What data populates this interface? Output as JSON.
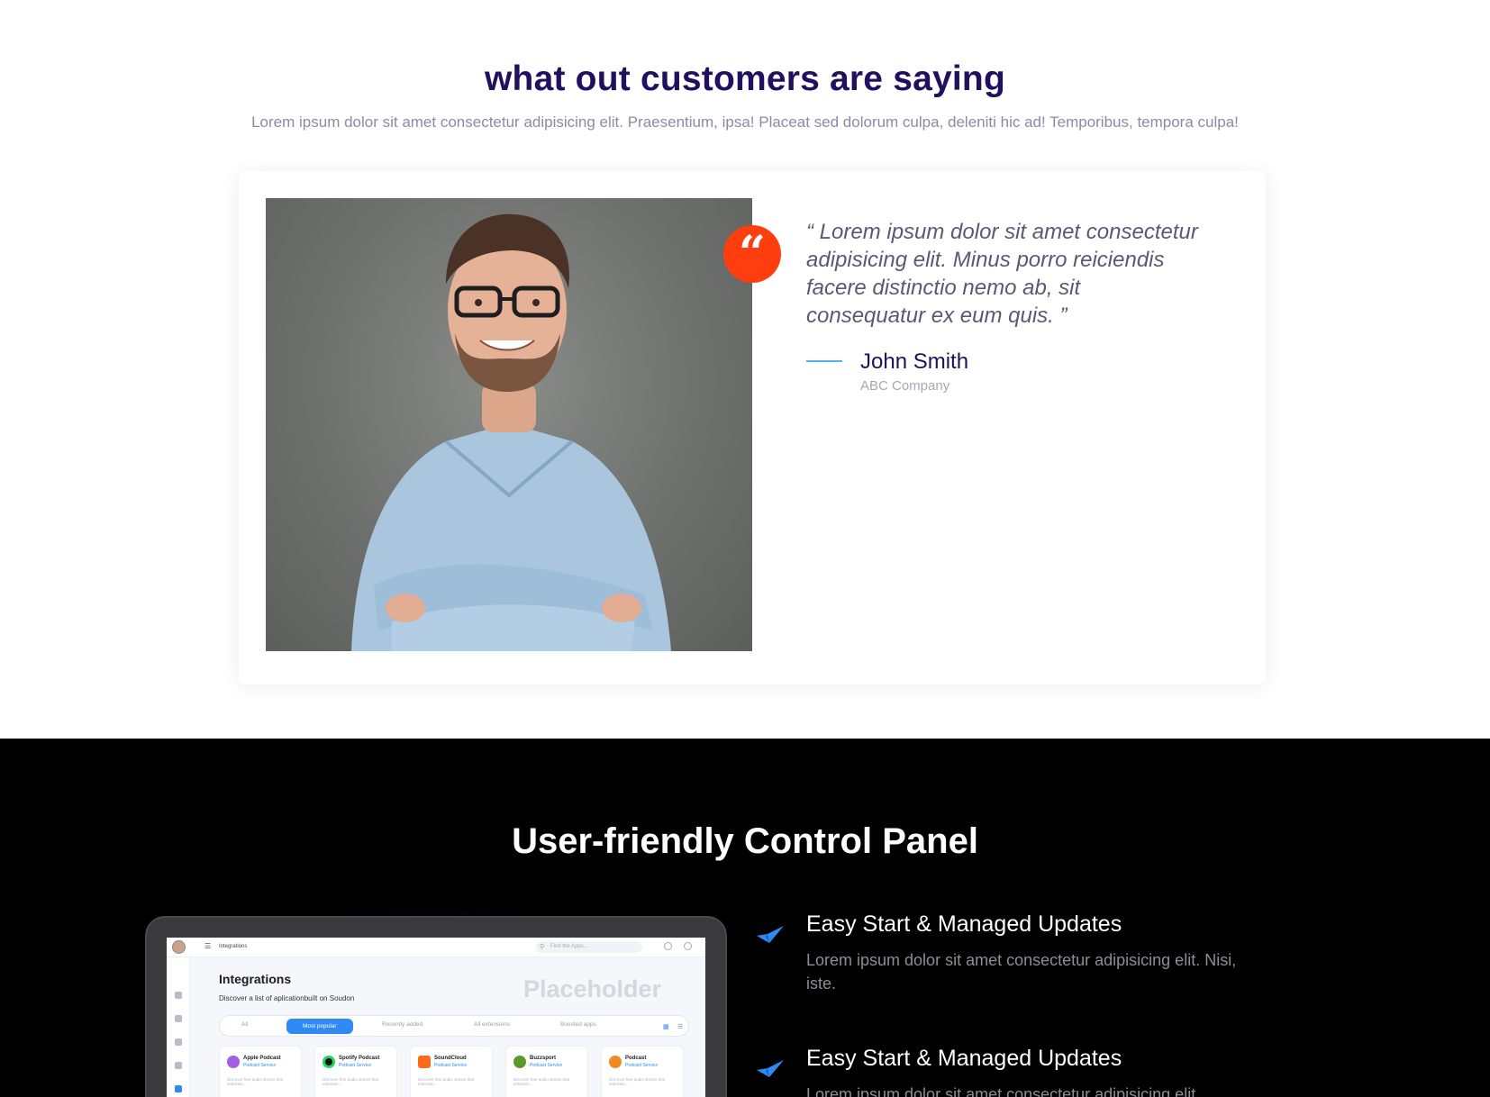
{
  "testimonials": {
    "title": "what out customers are saying",
    "subtitle": "Lorem ipsum dolor sit amet consectetur adipisicing elit. Praesentium, ipsa! Placeat sed dolorum culpa, deleniti hic ad! Temporibus, tempora culpa!",
    "quote": "“ Lorem ipsum dolor sit amet consectetur adipisicing elit. Minus porro reiciendis facere distinctio nemo ab, sit consequatur ex eum quis. ”",
    "author_name": "John Smith",
    "author_company": "ABC Company",
    "quote_icon": "quote-icon",
    "photo": "man-with-glasses-photo",
    "accent_color": "#ff3d0e",
    "title_color": "#1f1060"
  },
  "control_panel": {
    "title": "User-friendly Control Panel",
    "screen": {
      "breadcrumb": "Integrations",
      "search_placeholder": "Find the Apps...",
      "heading": "Integrations",
      "description": "Discover a list of aplicationbuilt on Soudon",
      "placeholder_watermark": "Placeholder",
      "tabs": [
        "All",
        "Most popular",
        "Recently added",
        "All extensions",
        "Boosted apps"
      ],
      "active_tab": "Most popular",
      "apps": [
        {
          "name": "Apple Podcast",
          "type": "Podcast Service",
          "desc": "Discover free audio stories that entertain..."
        },
        {
          "name": "Spotify Podcast",
          "type": "Podcast Service",
          "desc": "Discover free audio stories that entertain..."
        },
        {
          "name": "SoundCloud",
          "type": "Podcast Service",
          "desc": "Discover free audio stories that entertain..."
        },
        {
          "name": "Buzzsport",
          "type": "Podcast Service",
          "desc": "Discover free audio stories that entertain..."
        },
        {
          "name": "Podcast",
          "type": "Podcast Service",
          "desc": "Discover free audio stories that entertain..."
        }
      ]
    },
    "features": [
      {
        "title": "Easy Start & Managed Updates",
        "desc": "Lorem ipsum dolor sit amet consectetur adipisicing elit. Nisi, iste.",
        "icon": "check-arrow-icon"
      },
      {
        "title": "Easy Start & Managed Updates",
        "desc": "Lorem ipsum dolor sit amet consectetur adipisicing elit.",
        "icon": "check-arrow-icon"
      }
    ],
    "accent_color": "#2f8bf3"
  }
}
